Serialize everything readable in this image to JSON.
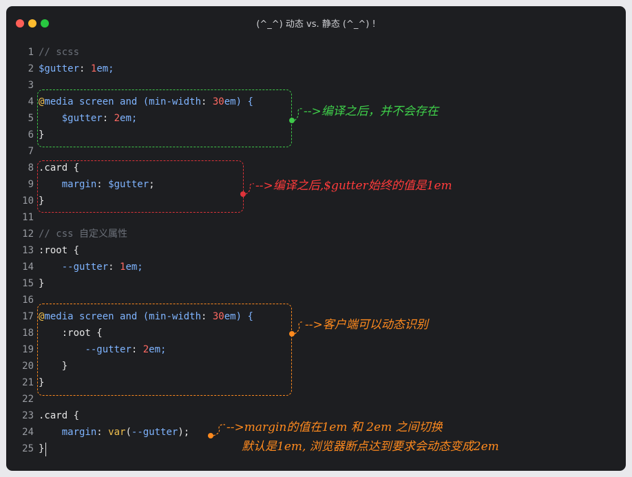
{
  "window": {
    "title": "(^_^) 动态 vs. 静态 (^_^) !"
  },
  "code_lines": [
    {
      "n": "1",
      "tokens": [
        {
          "t": "// scss",
          "c": "comment"
        }
      ]
    },
    {
      "n": "2",
      "tokens": [
        {
          "t": "$gutter",
          "c": "var"
        },
        {
          "t": ": ",
          "c": "punct"
        },
        {
          "t": "1",
          "c": "num"
        },
        {
          "t": "em;",
          "c": "kw"
        }
      ]
    },
    {
      "n": "3",
      "tokens": []
    },
    {
      "n": "4",
      "tokens": [
        {
          "t": "@",
          "c": "at"
        },
        {
          "t": "media screen and (",
          "c": "kw"
        },
        {
          "t": "min-width",
          "c": "kw"
        },
        {
          "t": ": ",
          "c": "punct"
        },
        {
          "t": "30",
          "c": "num"
        },
        {
          "t": "em) {",
          "c": "kw"
        }
      ]
    },
    {
      "n": "5",
      "tokens": [
        {
          "t": "    ",
          "c": "punct"
        },
        {
          "t": "$gutter",
          "c": "var"
        },
        {
          "t": ": ",
          "c": "punct"
        },
        {
          "t": "2",
          "c": "num"
        },
        {
          "t": "em;",
          "c": "kw"
        }
      ]
    },
    {
      "n": "6",
      "tokens": [
        {
          "t": "}",
          "c": "punct"
        }
      ]
    },
    {
      "n": "7",
      "tokens": []
    },
    {
      "n": "8",
      "tokens": [
        {
          "t": ".card {",
          "c": "sel"
        }
      ]
    },
    {
      "n": "9",
      "tokens": [
        {
          "t": "    ",
          "c": "punct"
        },
        {
          "t": "margin",
          "c": "prop"
        },
        {
          "t": ": ",
          "c": "punct"
        },
        {
          "t": "$gutter",
          "c": "var"
        },
        {
          "t": ";",
          "c": "punct"
        }
      ]
    },
    {
      "n": "10",
      "tokens": [
        {
          "t": "}",
          "c": "punct"
        }
      ]
    },
    {
      "n": "11",
      "tokens": []
    },
    {
      "n": "12",
      "tokens": [
        {
          "t": "// css 自定义属性",
          "c": "comment"
        }
      ]
    },
    {
      "n": "13",
      "tokens": [
        {
          "t": ":root {",
          "c": "sel"
        }
      ]
    },
    {
      "n": "14",
      "tokens": [
        {
          "t": "    ",
          "c": "punct"
        },
        {
          "t": "--gutter",
          "c": "prop"
        },
        {
          "t": ": ",
          "c": "punct"
        },
        {
          "t": "1",
          "c": "num"
        },
        {
          "t": "em;",
          "c": "kw"
        }
      ]
    },
    {
      "n": "15",
      "tokens": [
        {
          "t": "}",
          "c": "punct"
        }
      ]
    },
    {
      "n": "16",
      "tokens": []
    },
    {
      "n": "17",
      "tokens": [
        {
          "t": "@",
          "c": "at"
        },
        {
          "t": "media screen and (",
          "c": "kw"
        },
        {
          "t": "min-width",
          "c": "kw"
        },
        {
          "t": ": ",
          "c": "punct"
        },
        {
          "t": "30",
          "c": "num"
        },
        {
          "t": "em) {",
          "c": "kw"
        }
      ]
    },
    {
      "n": "18",
      "tokens": [
        {
          "t": "    ",
          "c": "punct"
        },
        {
          "t": ":root {",
          "c": "sel"
        }
      ]
    },
    {
      "n": "19",
      "tokens": [
        {
          "t": "        ",
          "c": "punct"
        },
        {
          "t": "--gutter",
          "c": "prop"
        },
        {
          "t": ": ",
          "c": "punct"
        },
        {
          "t": "2",
          "c": "num"
        },
        {
          "t": "em;",
          "c": "kw"
        }
      ]
    },
    {
      "n": "20",
      "tokens": [
        {
          "t": "    }",
          "c": "punct"
        }
      ]
    },
    {
      "n": "21",
      "tokens": [
        {
          "t": "}",
          "c": "punct"
        }
      ]
    },
    {
      "n": "22",
      "tokens": []
    },
    {
      "n": "23",
      "tokens": [
        {
          "t": ".card {",
          "c": "sel"
        }
      ]
    },
    {
      "n": "24",
      "tokens": [
        {
          "t": "    ",
          "c": "punct"
        },
        {
          "t": "margin",
          "c": "prop"
        },
        {
          "t": ": ",
          "c": "punct"
        },
        {
          "t": "var",
          "c": "fn"
        },
        {
          "t": "(",
          "c": "punct"
        },
        {
          "t": "--gutter",
          "c": "prop"
        },
        {
          "t": ");",
          "c": "punct"
        }
      ]
    },
    {
      "n": "25",
      "tokens": [
        {
          "t": "}",
          "c": "punct"
        }
      ]
    }
  ],
  "annotations": {
    "scss_media": "-->编译之后，并不会存在",
    "scss_card": "-->编译之后,$gutter始终的值是1em",
    "css_media": "-->客户端可以动态识别",
    "css_card_line1": "-->margin的值在1em 和 2em 之间切换",
    "css_card_line2": "默认是1em, 浏览器断点达到要求会动态变成2em"
  },
  "colors": {
    "window_bg": "#1d1e21",
    "annotation_green": "#3fd04a",
    "annotation_red": "#ff3b3b",
    "annotation_orange": "#ff8a1e"
  }
}
